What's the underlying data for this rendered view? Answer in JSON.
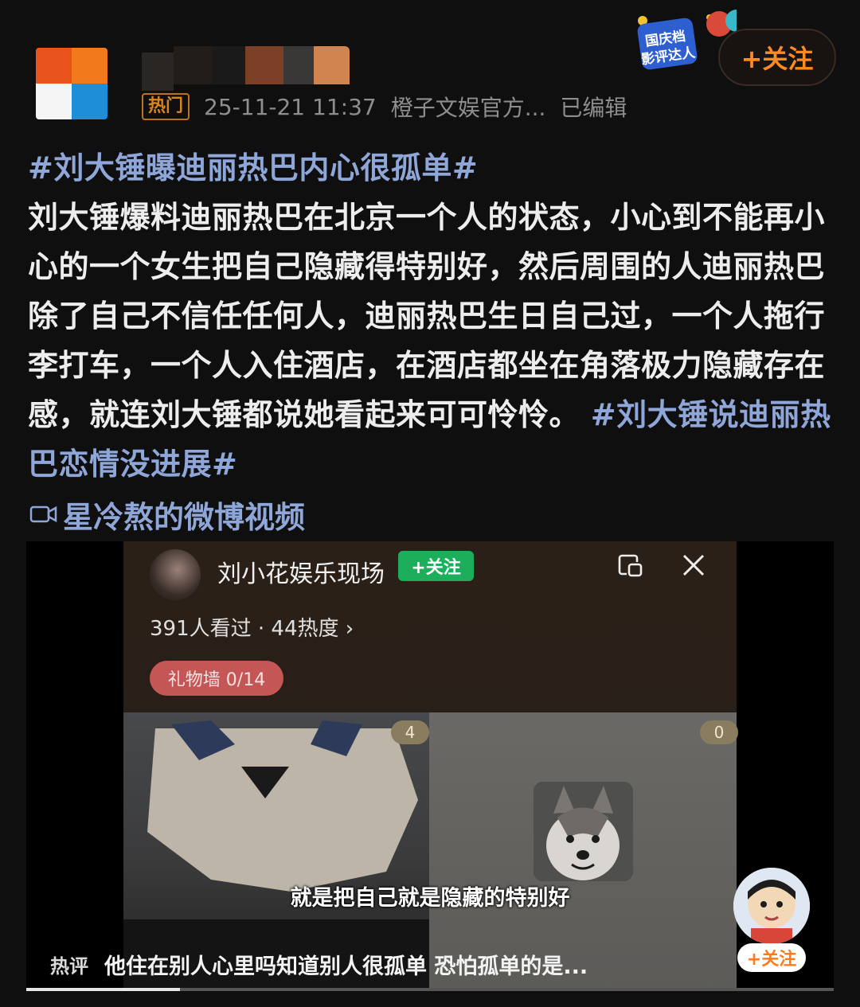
{
  "header": {
    "hot_tag": "热门",
    "timestamp": "25-11-21 11:37",
    "source": "橙子文娱官方...",
    "edited": "已编辑",
    "badge_text": "国庆档影评达人",
    "follow_label": "+关注"
  },
  "post": {
    "topic1": "#刘大锤曝迪丽热巴内心很孤单#",
    "body": "刘大锤爆料迪丽热巴在北京一个人的状态，小心到不能再小心的一个女生把自己隐藏得特别好，然后周围的人迪丽热巴除了自己不信任任何人，迪丽热巴生日自己过，一个人拖行李打车，一个人入住酒店，在酒店都坐在角落极力隐藏存在感，就连刘大锤都说她看起来可可怜怜。",
    "topic2": "#刘大锤说迪丽热巴恋情没进展#",
    "video_link": "星冷熬的微博视频"
  },
  "video": {
    "host_name": "刘小花娱乐现场",
    "host_follow": "+关注",
    "viewers": "391人看过 · 44热度 ›",
    "gift_wall": "礼物墙 0/14",
    "left_count": "4",
    "right_count": "0",
    "subtitle": "就是把自己就是隐藏的特别好",
    "cartoon_follow": "+关注",
    "hot_comment_label": "热评",
    "hot_comment": "他住在别人心里吗知道别人很孤单 恐怕孤单的是...",
    "progress": 0.19
  },
  "colors": {
    "topic": "#8fa6d8",
    "follow_orange": "#ff8a1e",
    "green_follow": "#1cae5a"
  }
}
